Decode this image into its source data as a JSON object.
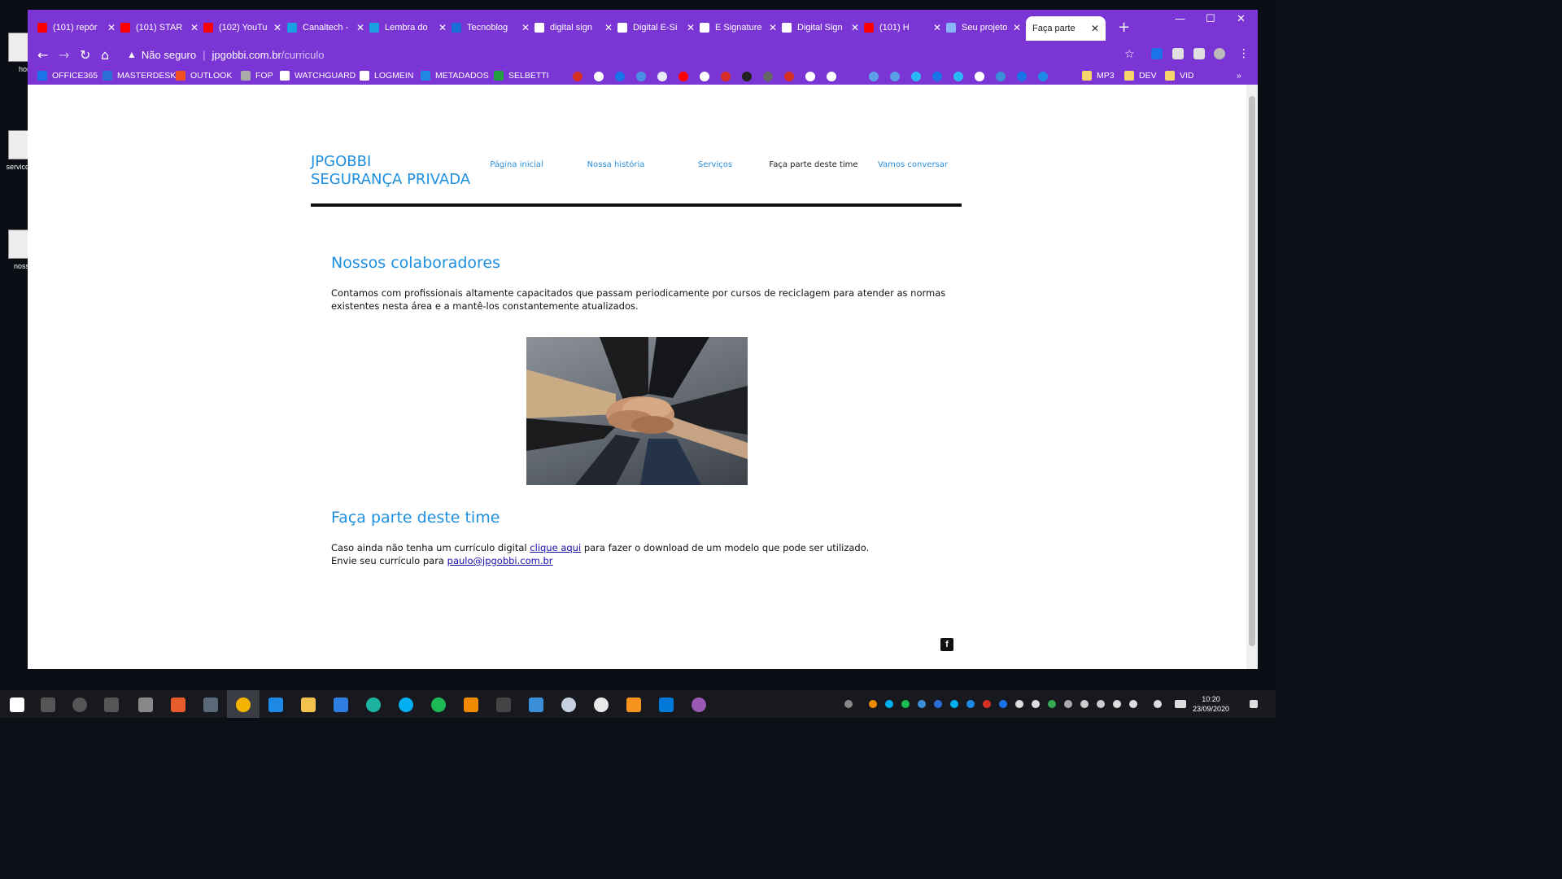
{
  "desktop": {
    "icons": [
      {
        "label": "hor"
      },
      {
        "label": "servico"
      },
      {
        "label": "noss"
      }
    ]
  },
  "browser": {
    "tabs": [
      {
        "label": "(101) repór",
        "icon": "youtube-icon",
        "color": "#ff0000"
      },
      {
        "label": "(101) STAR",
        "icon": "youtube-icon",
        "color": "#ff0000"
      },
      {
        "label": "(102) YouTu",
        "icon": "youtube-icon",
        "color": "#ff0000"
      },
      {
        "label": "Canaltech -",
        "icon": "canaltech-icon",
        "color": "#1aa0e0"
      },
      {
        "label": "Lembra do",
        "icon": "canaltech-icon",
        "color": "#1aa0e0"
      },
      {
        "label": "Tecnoblog",
        "icon": "tecnoblog-icon",
        "color": "#1a6fd6"
      },
      {
        "label": "digital sign",
        "icon": "google-icon",
        "color": "#ffffff"
      },
      {
        "label": "Digital E-Si",
        "icon": "u-icon",
        "color": "#ffffff"
      },
      {
        "label": "E Signature",
        "icon": "settings-icon",
        "color": "#ffffff"
      },
      {
        "label": "Digital Sign",
        "icon": "settings-icon",
        "color": "#ffffff"
      },
      {
        "label": "(101) H",
        "icon": "youtube-icon",
        "color": "#ff0000"
      },
      {
        "label": "Seu projeto",
        "icon": "loading-icon",
        "color": "#8ab4f8"
      },
      {
        "label": "Faça parte",
        "icon": "",
        "color": "",
        "active": true
      }
    ],
    "address": {
      "security": "Não seguro",
      "domain": "jpgobbi.com.br",
      "path": "/curriculo"
    },
    "bookmarks": [
      {
        "label": "OFFICE365",
        "color": "#1a73e8"
      },
      {
        "label": "MASTERDESK",
        "color": "#2b6fd6"
      },
      {
        "label": "OUTLOOK",
        "color": "#f25022"
      },
      {
        "label": "FOP",
        "color": "#aaaaaa"
      },
      {
        "label": "WATCHGUARD",
        "color": "#ffffff"
      },
      {
        "label": "LOGMEIN",
        "color": "#ffffff"
      },
      {
        "label": "METADADOS",
        "color": "#1e88e5"
      },
      {
        "label": "SELBETTI",
        "color": "#20a040"
      }
    ],
    "bookmark_folders": [
      "MP3",
      "DEV",
      "VID"
    ],
    "more": "»"
  },
  "site": {
    "logo_line1": "JPGOBBI",
    "logo_line2": "SEGURANÇA PRIVADA",
    "menu": [
      "Página inicial",
      "Nossa história",
      "Serviços",
      "Faça parte deste time",
      "Vamos conversar"
    ],
    "section1_title": "Nossos colaboradores",
    "section1_text": "Contamos com profissionais altamente capacitados que passam periodicamente por cursos de reciclagem para atender as normas existentes nesta área e a mantê-los constantemente atualizados.",
    "section2_title": "Faça parte deste time",
    "section2_pre": "Caso ainda não tenha um currículo digital ",
    "section2_link": "clique aqui",
    "section2_post": " para fazer o download de um modelo que pode ser utilizado.",
    "send_pre": "Envie seu currículo para ",
    "email": "paulo@jpgobbi.com.br",
    "facebook": "f"
  },
  "taskbar": {
    "time": "10:20",
    "date": "23/09/2020"
  }
}
